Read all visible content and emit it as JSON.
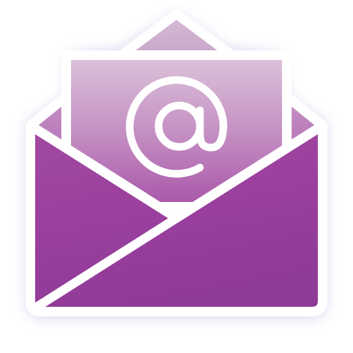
{
  "icon": {
    "name": "open-envelope-email-icon",
    "symbol": "@",
    "colors": {
      "primary": "#9b3f9e",
      "dark": "#8a2f8e",
      "light": "#d9bfd8",
      "outline": "#ffffff",
      "glow": "#c9b6e6"
    }
  }
}
